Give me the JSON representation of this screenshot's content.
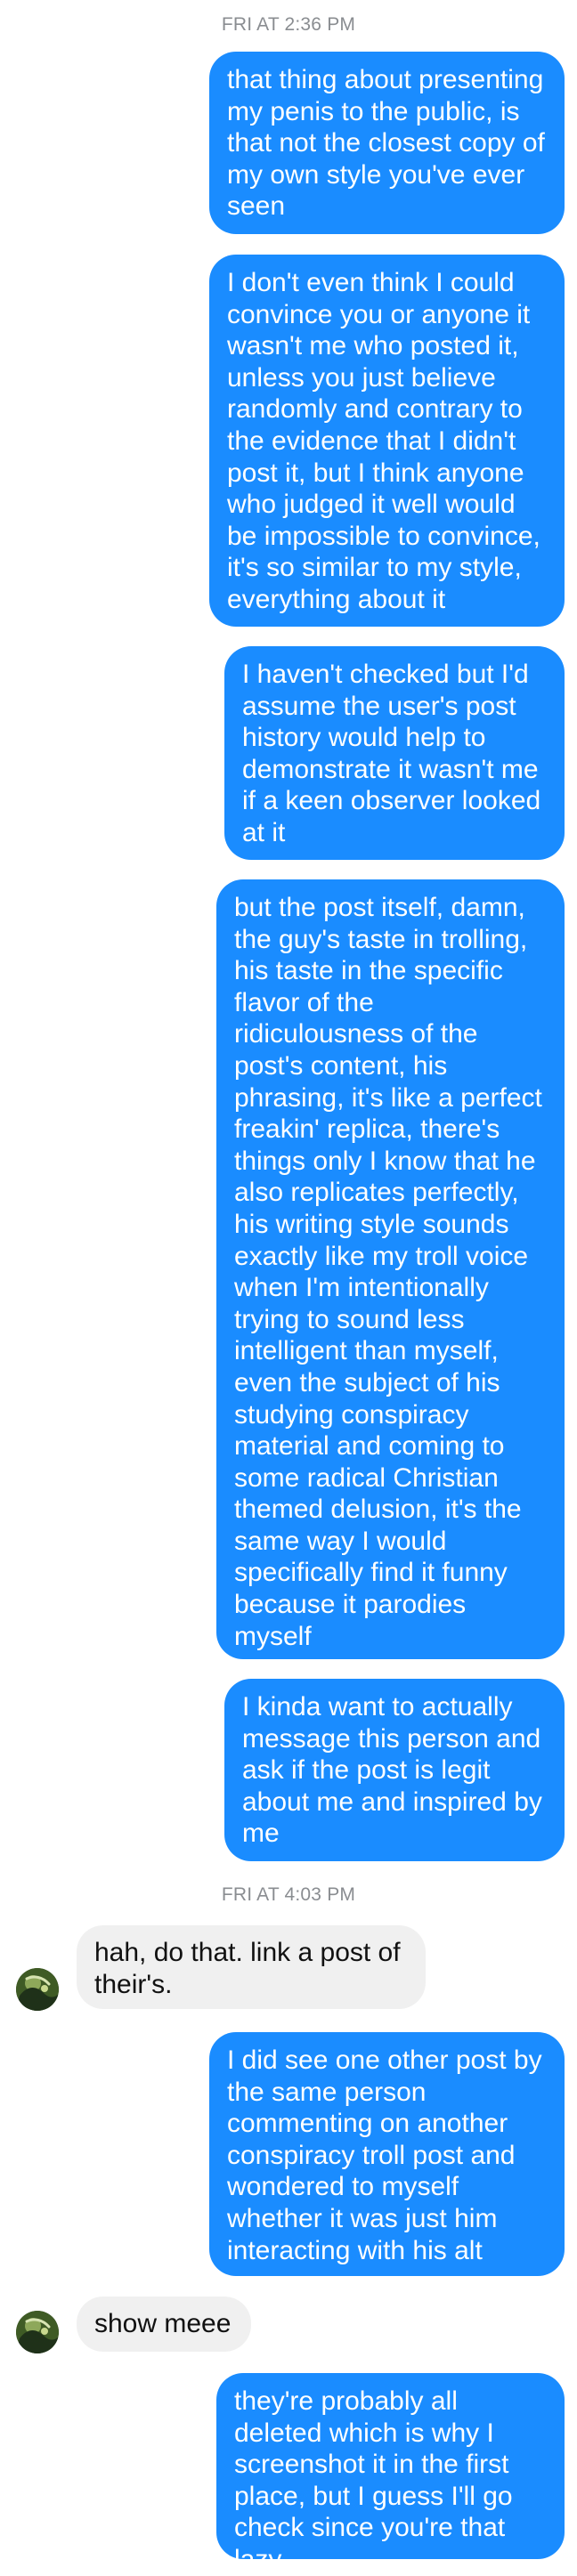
{
  "conversation": {
    "timestamps": [
      "FRI AT 2:36 PM",
      "FRI AT 4:03 PM"
    ],
    "messages": [
      {
        "text": "that thing about presenting my penis to the public, is that not the closest copy of my own style you've ever seen"
      },
      {
        "text": "I don't even think I could convince you or anyone it wasn't me who posted it, unless you just believe randomly and contrary to the evidence that I didn't post it, but I think anyone who judged it well would be impossible to convince, it's so similar to my style, everything about it"
      },
      {
        "text": "I haven't checked but I'd assume the user's post history would help to demonstrate it wasn't me if a keen observer looked at it"
      },
      {
        "text": "but the post itself, damn, the guy's taste in trolling, his taste in the specific flavor of the ridiculousness of the post's content, his phrasing, it's like a perfect freakin' replica, there's things only I know that he also replicates perfectly, his writing style sounds exactly like my troll voice when I'm intentionally trying to sound less intelligent than myself, even the subject of his studying conspiracy material and coming to some radical Christian themed delusion, it's the same way I would specifically find it funny because it parodies myself"
      },
      {
        "text": "I kinda want to actually message this person and ask if the post is legit about me and inspired by me"
      },
      {
        "text": "hah, do that. link a post of their's."
      },
      {
        "text": "I did see one other post by the same person commenting on another conspiracy troll post and wondered to myself whether it was just him interacting with his alt"
      },
      {
        "text": "show meee"
      },
      {
        "text": "they're probably all deleted which is why I screenshot it in the first place, but I guess I'll go check since you're that lazy"
      }
    ]
  }
}
